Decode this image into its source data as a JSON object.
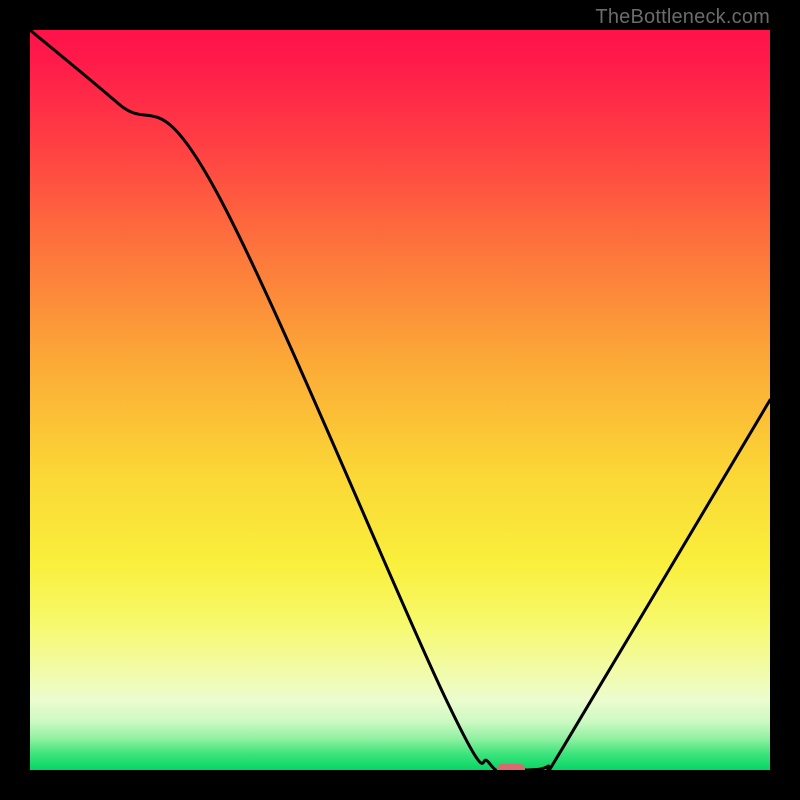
{
  "watermark": "TheBottleneck.com",
  "chart_data": {
    "type": "line",
    "title": "",
    "xlabel": "",
    "ylabel": "",
    "xlim": [
      0,
      100
    ],
    "ylim": [
      0,
      100
    ],
    "series": [
      {
        "name": "bottleneck-curve",
        "x": [
          0,
          12,
          25,
          56,
          62,
          64,
          67,
          70,
          72,
          100
        ],
        "values": [
          100,
          90,
          78.5,
          10,
          1,
          0,
          0,
          0.5,
          3,
          50
        ]
      }
    ],
    "marker": {
      "name": "optimal-point",
      "x": 65,
      "y": 0,
      "color": "#d96a6f"
    },
    "gradient_stops": [
      {
        "offset": 0.0,
        "color": "#ff124a"
      },
      {
        "offset": 0.04,
        "color": "#ff1a4a"
      },
      {
        "offset": 0.16,
        "color": "#ff4143"
      },
      {
        "offset": 0.3,
        "color": "#fd763c"
      },
      {
        "offset": 0.45,
        "color": "#fbaa37"
      },
      {
        "offset": 0.6,
        "color": "#fbd736"
      },
      {
        "offset": 0.72,
        "color": "#f9ef3c"
      },
      {
        "offset": 0.8,
        "color": "#f7f96b"
      },
      {
        "offset": 0.86,
        "color": "#f2fba2"
      },
      {
        "offset": 0.905,
        "color": "#ecfcce"
      },
      {
        "offset": 0.935,
        "color": "#ccf9c2"
      },
      {
        "offset": 0.958,
        "color": "#8ff0a0"
      },
      {
        "offset": 0.978,
        "color": "#3de47c"
      },
      {
        "offset": 1.0,
        "color": "#06d665"
      }
    ]
  }
}
